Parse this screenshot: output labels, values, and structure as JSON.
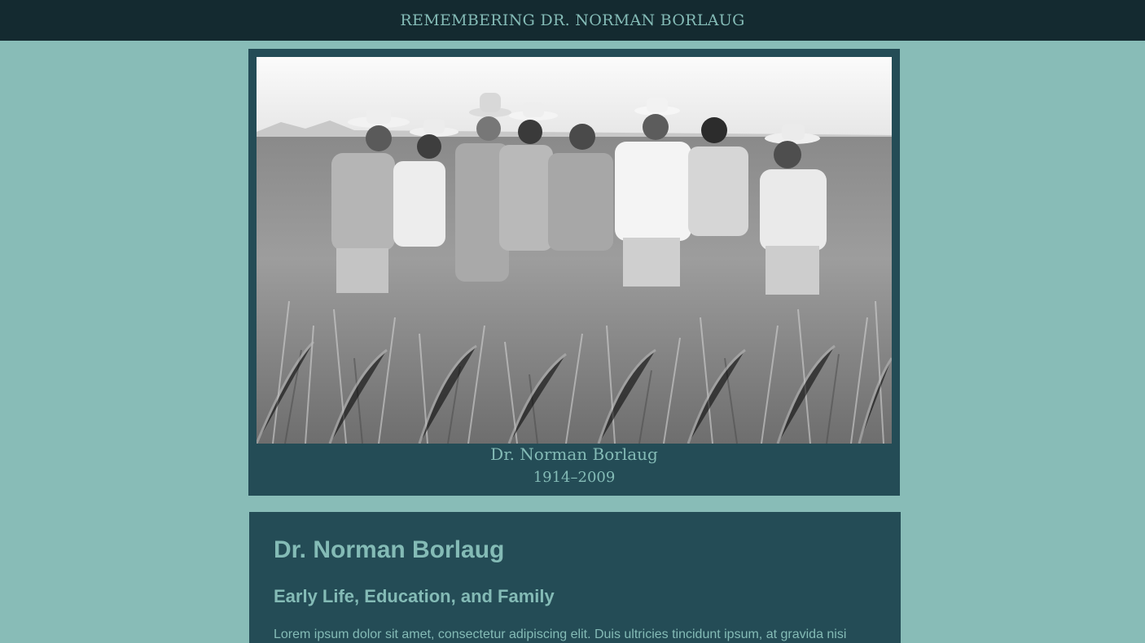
{
  "header": {
    "title": "REMEMBERING DR. NORMAN BORLAUG"
  },
  "hero": {
    "photo_icon": "historical-photo",
    "photo_alt": "Black and white photograph of Dr. Norman Borlaug with colleagues standing in a wheat field",
    "caption_name": "Dr. Norman Borlaug",
    "caption_years": "1914–2009"
  },
  "content": {
    "title": "Dr. Norman Borlaug",
    "subtitle": "Early Life, Education, and Family",
    "body": "Lorem ipsum dolor sit amet, consectetur adipiscing elit. Duis ultricies tincidunt ipsum, at gravida nisi"
  },
  "colors": {
    "page_bg": "#88bcb7",
    "header_bg": "#142a30",
    "card_bg": "#244c56",
    "accent_text": "#84bbb6"
  }
}
